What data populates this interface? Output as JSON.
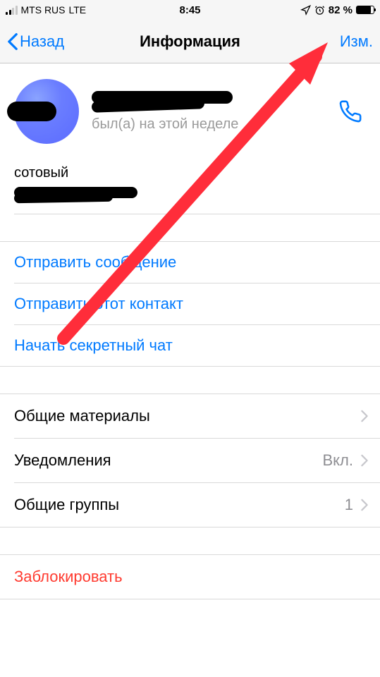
{
  "status": {
    "carrier": "MTS RUS",
    "network": "LTE",
    "time": "8:45",
    "battery_pct": "82 %"
  },
  "nav": {
    "back_label": "Назад",
    "title": "Информация",
    "edit_label": "Изм."
  },
  "profile": {
    "last_seen": "был(а) на этой неделе"
  },
  "phone": {
    "label": "сотовый"
  },
  "actions": {
    "send_message": "Отправить сообщение",
    "send_contact": "Отправить этот контакт",
    "secret_chat": "Начать секретный чат"
  },
  "settings": {
    "shared_media": "Общие материалы",
    "notifications_label": "Уведомления",
    "notifications_value": "Вкл.",
    "groups_label": "Общие группы",
    "groups_count": "1"
  },
  "block": {
    "label": "Заблокировать"
  }
}
